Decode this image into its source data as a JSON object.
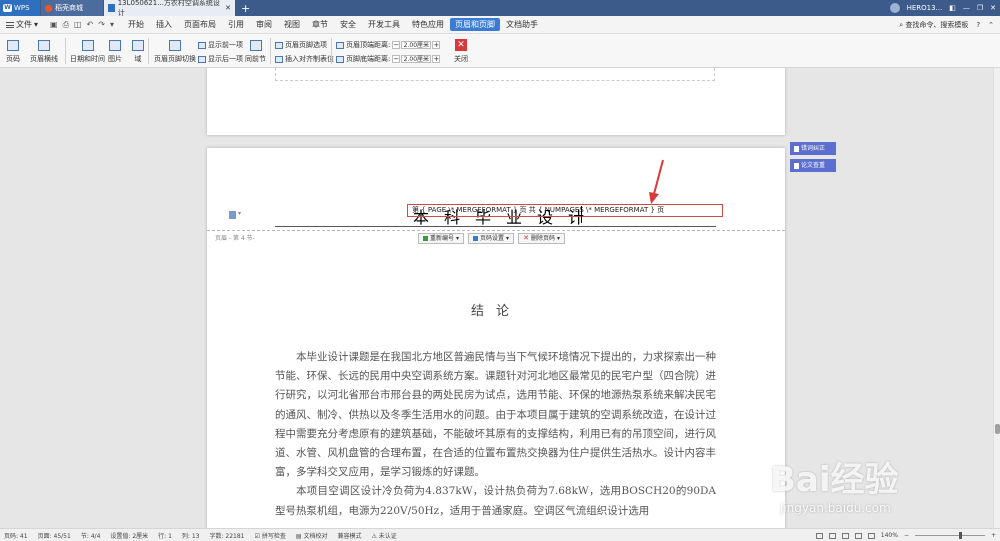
{
  "titlebar": {
    "app": "WPS",
    "tabs": [
      {
        "label": "稻壳商城"
      },
      {
        "label": "13L050621...方农村空调系统设计"
      }
    ],
    "add_tab": "+",
    "user": "HERO13..."
  },
  "menubar": {
    "file": "文件",
    "items": [
      "开始",
      "插入",
      "页面布局",
      "引用",
      "审阅",
      "视图",
      "章节",
      "安全",
      "开发工具",
      "特色应用",
      "页眉和页脚",
      "文档助手"
    ],
    "active": "页眉和页脚",
    "search": "查找命令、搜索模板",
    "help": "?"
  },
  "ribbon": {
    "page_number": "页码",
    "header_border": "页眉横线",
    "date_time": "日期和时间",
    "picture": "图片",
    "field": "域",
    "switch_header_footer": "页眉页脚切换",
    "show_prev": "显示前一项",
    "show_next": "显示后一项",
    "same_as_prev": "同前节",
    "header_footer_options": "页眉页脚选项",
    "insert_align_tab": "插入对齐制表位",
    "header_top_distance_label": "页眉顶端距离:",
    "header_top_distance_value": "2.00厘米",
    "footer_bottom_distance_label": "页脚底端距离:",
    "footer_bottom_distance_value": "2.00厘米",
    "close": "关闭"
  },
  "document": {
    "header_title": "本科毕业设计",
    "field_code": "第 { PAGE   \\* MERGEFORMAT } 页 共 { NUMPAGES   \\* MERGEFORMAT } 页",
    "header_label": "页眉 - 第 4 节-",
    "header_buttons": {
      "renumber": "重新编号",
      "page_settings": "页码设置",
      "delete_page_number": "删除页码"
    },
    "heading": "结论",
    "paragraphs": [
      "本毕业设计课题是在我国北方地区普遍民情与当下气候环境情况下提出的，力求探索出一种节能、环保、长远的民用中央空调系统方案。课题针对河北地区最常见的民宅户型（四合院）进行研究，以河北省邢台市邢台县的两处民房为试点，选用节能、环保的地源热泵系统来解决民宅的通风、制冷、供热以及冬季生活用水的问题。由于本项目属于建筑的空调系统改造，在设计过程中需要充分考虑原有的建筑基础，不能破坏其原有的支撑结构，利用已有的吊顶空间，进行风道、水管、风机盘管的合理布置，在合适的位置布置热交换器为住户提供生活热水。设计内容丰富，多学科交叉应用，是学习锻炼的好课题。",
      "本项目空调区设计冷负荷为4.837kW，设计热负荷为7.68kW，选用BOSCH20的90DA型号热泵机组，电源为220V/50Hz，适用于普通家庭。空调区气流组织设计选用"
    ]
  },
  "side_buttons": {
    "proofread": "错词纠正",
    "plagiarism": "论文查重"
  },
  "statusbar": {
    "page_number": "页码: 41",
    "page": "页面: 45/51",
    "section": "节: 4/4",
    "setting": "设置值: 2厘米",
    "row": "行: 1",
    "column": "列: 13",
    "word_count": "字数: 22181",
    "spell_check": "拼写检查",
    "doc_proofread": "文档校对",
    "compat_mode": "兼容模式",
    "unauth": "未认证",
    "zoom": "140%"
  },
  "watermark": {
    "brand": "Bai经验",
    "url": "jingyan.baidu.com"
  },
  "colors": {
    "titlebar": "#3c5a8a",
    "accent": "#3a7bd5",
    "annotation_red": "#d9383a",
    "side_button": "#5a6fd0"
  }
}
